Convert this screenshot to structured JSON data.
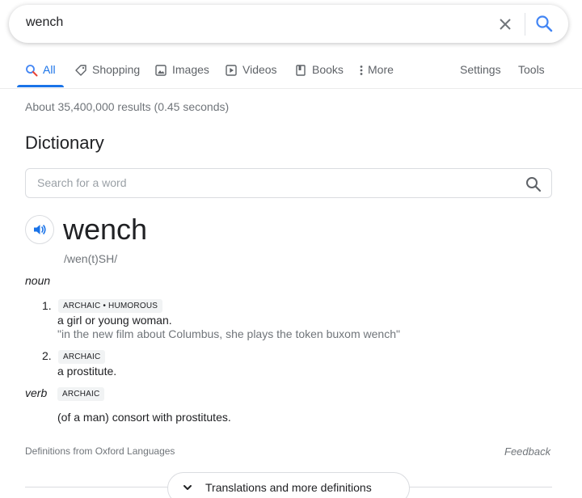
{
  "search": {
    "query": "wench"
  },
  "tabs": [
    {
      "label": "All",
      "icon": "search-icon",
      "active": true
    },
    {
      "label": "Shopping",
      "icon": "tag-icon"
    },
    {
      "label": "Images",
      "icon": "image-icon"
    },
    {
      "label": "Videos",
      "icon": "play-icon"
    },
    {
      "label": "Books",
      "icon": "book-icon"
    },
    {
      "label": "More",
      "icon": "more-vert-icon"
    },
    {
      "label": "Settings"
    },
    {
      "label": "Tools"
    }
  ],
  "stats": "About 35,400,000 results (0.45 seconds)",
  "dictionary": {
    "title": "Dictionary",
    "search_placeholder": "Search for a word",
    "word": "wench",
    "phonetic": "/wen(t)SH/",
    "noun": {
      "label": "noun",
      "senses": [
        {
          "number": "1.",
          "tag": "ARCHAIC • HUMOROUS",
          "definition": "a girl or young woman.",
          "example": "\"in the new film about Columbus, she plays the token buxom wench\""
        },
        {
          "number": "2.",
          "tag": "ARCHAIC",
          "definition": "a prostitute."
        }
      ]
    },
    "verb": {
      "label": "verb",
      "tag": "ARCHAIC",
      "definition": "(of a man) consort with prostitutes."
    },
    "source": "Definitions from Oxford Languages",
    "feedback": "Feedback",
    "more_button": "Translations and more definitions"
  },
  "colors": {
    "accent": "#1a73e8",
    "muted": "#70757a",
    "text": "#202124"
  }
}
